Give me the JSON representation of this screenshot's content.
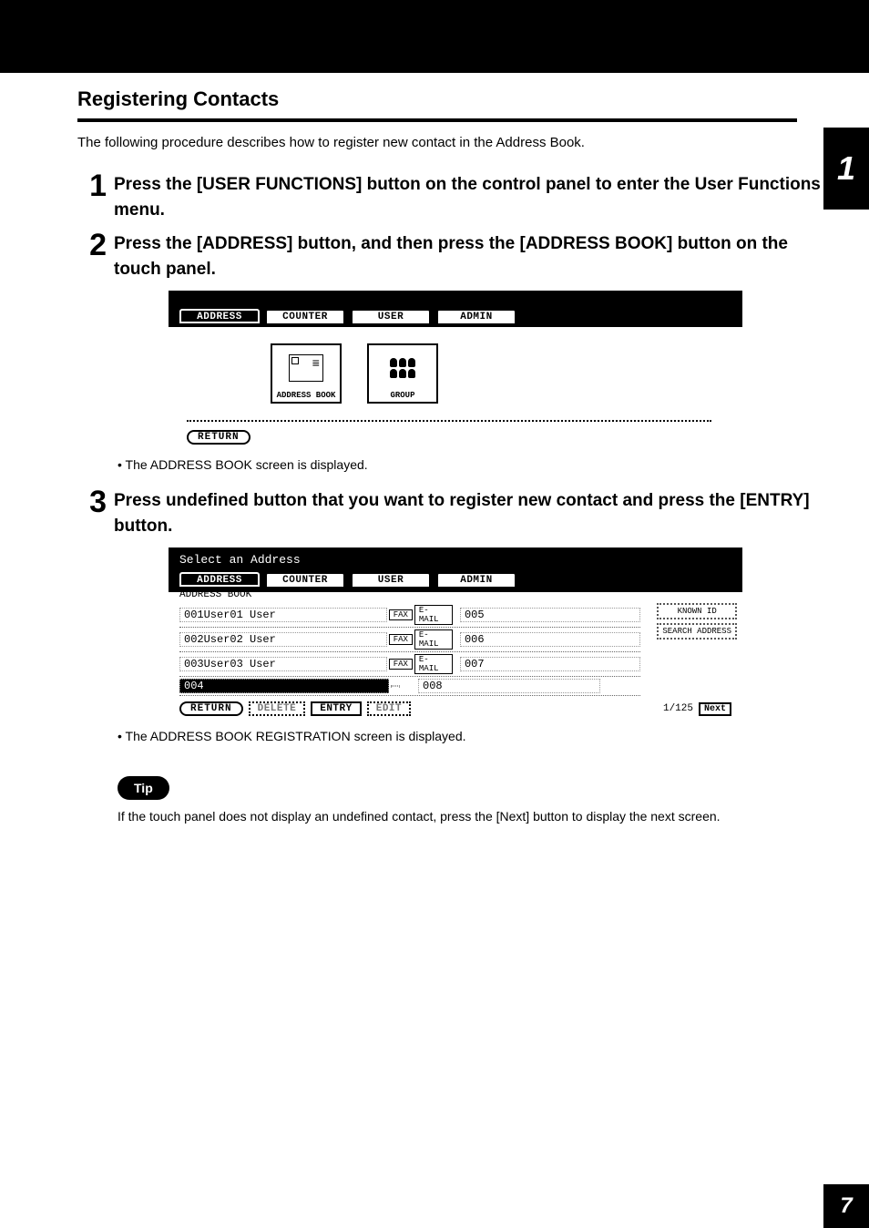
{
  "section_title": "Registering Contacts",
  "intro_text": "The following procedure describes how to register new contact in the Address Book.",
  "side_tab_chapter": "1",
  "page_number": "7",
  "steps": {
    "s1": {
      "num": "1",
      "text": "Press the [USER FUNCTIONS] button on the control panel to enter the User Functions menu."
    },
    "s2": {
      "num": "2",
      "text": "Press the [ADDRESS] button, and then press the [ADDRESS BOOK] button on the touch panel."
    },
    "s2_note": "The ADDRESS BOOK screen is displayed.",
    "s3": {
      "num": "3",
      "text": "Press undefined button that you want to register new contact and press the [ENTRY] button."
    },
    "s3_note": "The ADDRESS BOOK REGISTRATION screen is displayed."
  },
  "tip": {
    "badge": "Tip",
    "text": "If the touch panel does not display an undefined contact, press the [Next] button to display the next screen."
  },
  "panel1": {
    "tabs": {
      "address": "ADDRESS",
      "counter": "COUNTER",
      "user": "USER",
      "admin": "ADMIN"
    },
    "buttons": {
      "address_book": "ADDRESS BOOK",
      "group": "GROUP"
    },
    "return_btn": "RETURN"
  },
  "panel2": {
    "title": "Select an Address",
    "tabs": {
      "address": "ADDRESS",
      "counter": "COUNTER",
      "user": "USER",
      "admin": "ADMIN"
    },
    "crumb": "ADDRESS BOOK",
    "rows": [
      {
        "left": "001User01 User",
        "fax": "FAX",
        "email": "E-MAIL",
        "right": "005",
        "selected": false
      },
      {
        "left": "002User02 User",
        "fax": "FAX",
        "email": "E-MAIL",
        "right": "006",
        "selected": false
      },
      {
        "left": "003User03 User",
        "fax": "FAX",
        "email": "E-MAIL",
        "right": "007",
        "selected": false
      },
      {
        "left": "004",
        "fax": "",
        "email": "",
        "right": "008",
        "selected": true
      }
    ],
    "side_actions": {
      "known_id": "KNOWN ID",
      "search_address": "SEARCH ADDRESS"
    },
    "footer": {
      "return_btn": "RETURN",
      "delete_btn": "DELETE",
      "entry_btn": "ENTRY",
      "edit_btn": "EDIT",
      "page_counter": "1/125",
      "next_btn": "Next"
    }
  }
}
